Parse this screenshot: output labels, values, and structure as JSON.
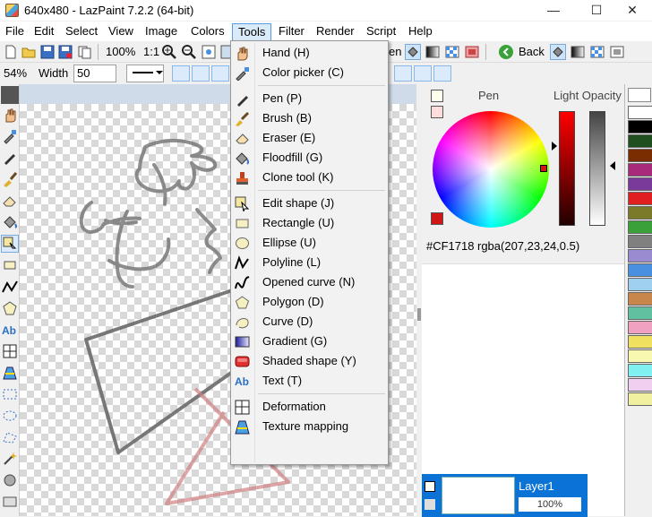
{
  "window": {
    "title": "640x480 - LazPaint 7.2.2 (64-bit)",
    "minimize": "—",
    "maximize": "☐",
    "close": "✕"
  },
  "menu": [
    "File",
    "Edit",
    "Select",
    "View",
    "Image",
    "Colors",
    "Tools",
    "Filter",
    "Render",
    "Script",
    "Help"
  ],
  "active_menu": "Tools",
  "toolbar": {
    "zoom": "100%",
    "ratio": "1:1",
    "back_label": "Back",
    "pen_fragment": "en"
  },
  "toolbar2": {
    "zoom_value": "54%",
    "width_label": "Width",
    "width_value": "50"
  },
  "tools_menu": [
    {
      "label": "Hand (H)",
      "icon": "hand-icon"
    },
    {
      "label": "Color picker (C)",
      "icon": "color-picker-icon"
    },
    {
      "label": "Pen (P)",
      "icon": "pen-icon"
    },
    {
      "label": "Brush (B)",
      "icon": "brush-icon"
    },
    {
      "label": "Eraser (E)",
      "icon": "eraser-icon"
    },
    {
      "label": "Floodfill (G)",
      "icon": "floodfill-icon"
    },
    {
      "label": "Clone tool (K)",
      "icon": "clone-tool-icon"
    },
    {
      "label": "Edit shape (J)",
      "icon": "edit-shape-icon"
    },
    {
      "label": "Rectangle (U)",
      "icon": "rectangle-icon"
    },
    {
      "label": "Ellipse (U)",
      "icon": "ellipse-icon"
    },
    {
      "label": "Polyline (L)",
      "icon": "polyline-icon"
    },
    {
      "label": "Opened curve (N)",
      "icon": "opened-curve-icon"
    },
    {
      "label": "Polygon (D)",
      "icon": "polygon-icon"
    },
    {
      "label": "Curve (D)",
      "icon": "curve-icon"
    },
    {
      "label": "Gradient (G)",
      "icon": "gradient-icon"
    },
    {
      "label": "Shaded shape (Y)",
      "icon": "shaded-shape-icon"
    },
    {
      "label": "Text (T)",
      "icon": "text-icon"
    },
    {
      "label": "Deformation",
      "icon": "deformation-icon"
    },
    {
      "label": "Texture mapping",
      "icon": "texture-mapping-icon"
    }
  ],
  "color_panel": {
    "pen_label": "Pen",
    "opacity_label": "Light Opacity",
    "hex": "#CF1718",
    "rgba": "rgba(207,23,24,0.5)",
    "pen_color": "#CF1718"
  },
  "layers": {
    "layer_name": "Layer1",
    "opacity": "100%"
  },
  "palette_colors": [
    "#ffffff",
    "#000000",
    "#1f4e1f",
    "#7a2d00",
    "#a82a7a",
    "#7a3a9a",
    "#e02020",
    "#7a7a2a",
    "#3aa03a",
    "#808080",
    "#9a8ad0",
    "#4a90e0",
    "#a0d0f0",
    "#c8864a",
    "#60c0a0",
    "#f0a0c0",
    "#f0e060",
    "#f8f8b0",
    "#80f0f0",
    "#f0d0f0",
    "#f0f0a0"
  ],
  "accent": "#0078d7"
}
